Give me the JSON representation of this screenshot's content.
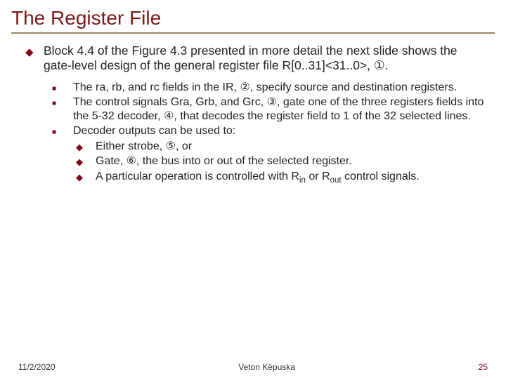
{
  "title": "The Register File",
  "main_bullet": "Block 4.4 of the Figure 4.3 presented in more detail the next slide shows the gate-level design of the general register file R[0..31]<31..0>, ①.",
  "sub_bullets": [
    "The ra, rb, and rc fields in the IR, ②, specify source and destination registers.",
    "The control signals Gra, Grb, and Grc, ③, gate one of the three registers fields into the 5-32 decoder, ④, that decodes the register field to 1 of the 32 selected lines.",
    "Decoder outputs can be used to:"
  ],
  "sub_sub_bullets": [
    "Either strobe, ⑤, or",
    "Gate, ⑥, the bus into or out of the selected register.",
    "__RINROUT__"
  ],
  "rinrout_prefix": "A particular operation is controlled with R",
  "rinrout_in": "in",
  "rinrout_or": " or R",
  "rinrout_out": "out",
  "rinrout_suffix": " control signals.",
  "footer": {
    "date": "11/2/2020",
    "author": "Veton Këpuska",
    "page": "25"
  }
}
